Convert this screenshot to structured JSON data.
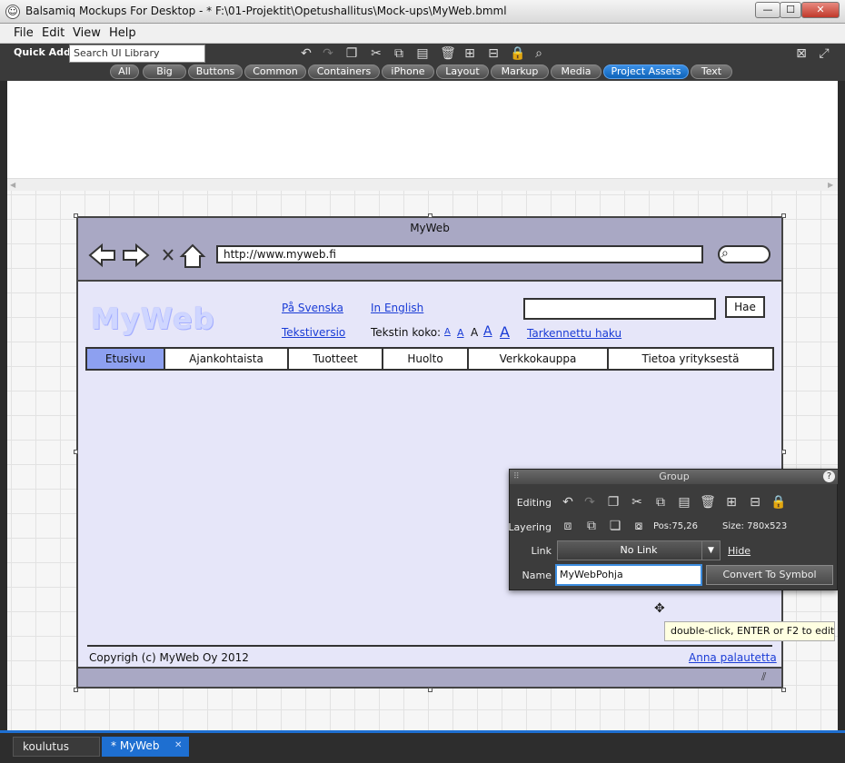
{
  "window": {
    "title": "Balsamiq Mockups For Desktop - * F:\\01-Projektit\\Opetushallitus\\Mock-ups\\MyWeb.bmml",
    "minimize": "—",
    "maximize": "☐",
    "close": "✕"
  },
  "menu": [
    "File",
    "Edit",
    "View",
    "Help"
  ],
  "quick_add": {
    "label": "Quick Add:",
    "search_value": "Search UI Library"
  },
  "library_tabs": [
    "All",
    "Big",
    "Buttons",
    "Common",
    "Containers",
    "iPhone",
    "Layout",
    "Markup",
    "Media",
    "Project Assets",
    "Text"
  ],
  "active_library_tab": "Project Assets",
  "mockup": {
    "browser_title": "MyWeb",
    "url": "http://www.myweb.fi",
    "logo": "MyWeb",
    "link_svenska": "På Svenska",
    "link_english": "In English",
    "link_tekstiversio": "Tekstiversio",
    "tekstin_koko_label": "Tekstin koko:",
    "size_letter": "A",
    "link_tarkennettu": "Tarkennettu haku",
    "search_button": "Hae",
    "nav": [
      "Etusivu",
      "Ajankohtaista",
      "Tuotteet",
      "Huolto",
      "Verkkokauppa",
      "Tietoa yrityksestä"
    ],
    "copyright": "Copyrigh (c) MyWeb Oy  2012",
    "feedback": "Anna palautetta"
  },
  "inspector": {
    "title": "Group",
    "help": "?",
    "editing_label": "Editing",
    "layering_label": "Layering",
    "pos_label": "Pos:",
    "pos_value": "75,26",
    "size_label": "Size:",
    "size_value": "780x523",
    "link_label": "Link",
    "link_value": "No Link",
    "hide": "Hide",
    "name_label": "Name",
    "name_value": "MyWebPohja",
    "convert": "Convert To Symbol"
  },
  "tooltip": "double-click, ENTER or F2 to edit",
  "doc_tabs": {
    "tab1": "koulutus",
    "tab2": "* MyWeb",
    "close": "✕"
  },
  "colors": {
    "accent": "#1e6fd1",
    "mock_bg": "#e6e6f9",
    "mock_chrome": "#a9a8c4",
    "active_nav": "#8da0f0"
  }
}
